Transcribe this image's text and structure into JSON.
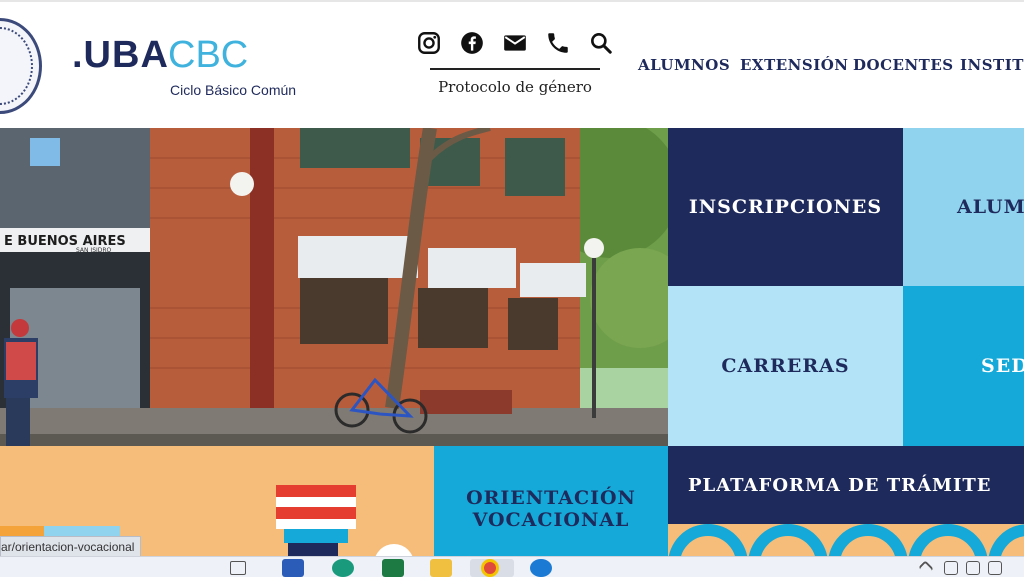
{
  "header": {
    "logo_uba": ".UBA",
    "logo_cbc": "CBC",
    "logo_subtitle": "Ciclo Básico Común",
    "seal_icon": "uba-seal-icon",
    "social_icons": [
      "instagram-icon",
      "facebook-icon",
      "mail-icon",
      "phone-icon",
      "search-icon"
    ],
    "protocolo_link": "Protocolo de género",
    "nav": [
      "ALUMNOS",
      "EXTENSIÓN",
      "DOCENTES",
      "INSTITUC"
    ]
  },
  "hero": {
    "sign_line1": "E  BUENOS  AIRES",
    "sign_line2": "SAN ISIDRO"
  },
  "tiles": {
    "inscripciones": "INSCRIPCIONES",
    "alumnos": "ALUM",
    "carreras": "CARRERAS",
    "sedes": "SED",
    "orientacion_line1": "ORIENTACIÓN",
    "orientacion_line2": "VOCACIONAL",
    "plataforma": "PLATAFORMA DE TRÁMITE"
  },
  "status_url": "ar/orientacion-vocacional",
  "colors": {
    "navy": "#1f2a5c",
    "light_blue": "#8fd3ee",
    "pale_blue": "#b3e3f6",
    "cyan": "#14a9d8",
    "orange": "#f6bd7a"
  },
  "taskbar_icons": [
    "task-view-icon",
    "word-icon",
    "edge-icon",
    "excel-icon",
    "file-explorer-icon",
    "chrome-icon",
    "cloud-app-icon"
  ]
}
